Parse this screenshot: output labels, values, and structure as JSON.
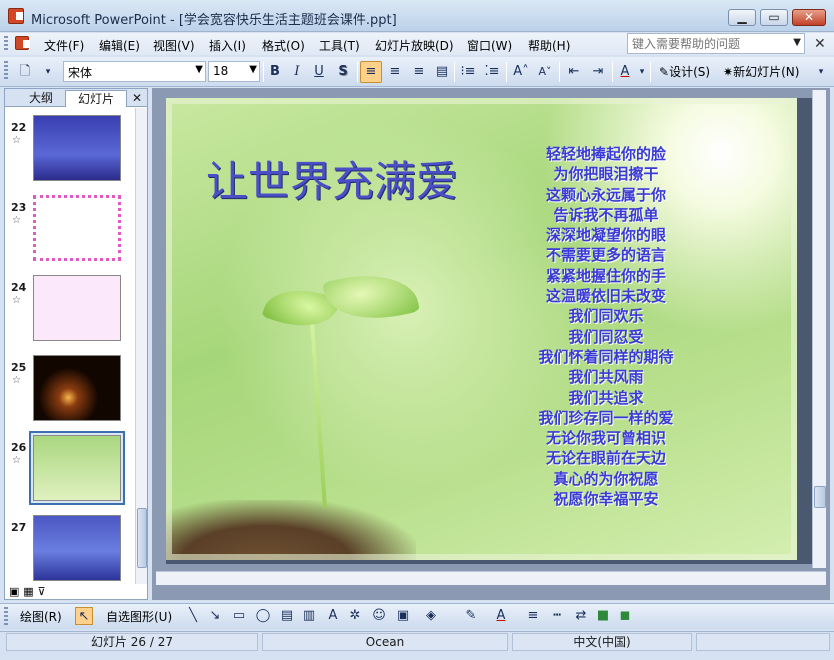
{
  "window": {
    "title": "Microsoft PowerPoint - [学会宽容快乐生活主题班会课件.ppt]"
  },
  "menu": {
    "items": [
      "文件(F)",
      "编辑(E)",
      "视图(V)",
      "插入(I)",
      "格式(O)",
      "工具(T)",
      "幻灯片放映(D)",
      "窗口(W)",
      "帮助(H)"
    ],
    "help_placeholder": "键入需要帮助的问题"
  },
  "toolbar": {
    "font": "宋体",
    "size": "18",
    "bold": "B",
    "italic": "I",
    "underline": "U",
    "shadow": "S",
    "design": "设计(S)",
    "new_slide": "新幻灯片(N)"
  },
  "panel": {
    "tabs": [
      "大纲",
      "幻灯片"
    ],
    "slide_numbers": [
      "22",
      "23",
      "24",
      "25",
      "26",
      "27"
    ],
    "selected": "26"
  },
  "slide": {
    "title": "让世界充满爱",
    "poem": [
      "轻轻地捧起你的脸",
      "为你把眼泪擦干",
      "这颗心永远属于你",
      "告诉我不再孤单",
      "深深地凝望你的眼",
      "不需要更多的语言",
      "紧紧地握住你的手",
      "这温暖依旧未改变",
      "我们同欢乐",
      "我们同忍受",
      "我们怀着同样的期待",
      "我们共风雨",
      "我们共追求",
      "我们珍存同一样的爱",
      "无论你我可曾相识",
      "无论在眼前在天边",
      "真心的为你祝愿",
      "祝愿你幸福平安"
    ]
  },
  "drawbar": {
    "draw": "绘图(R)",
    "autoshapes": "自选图形(U)"
  },
  "status": {
    "slide": "幻灯片 26 / 27",
    "design": "Ocean",
    "language": "中文(中国)"
  }
}
